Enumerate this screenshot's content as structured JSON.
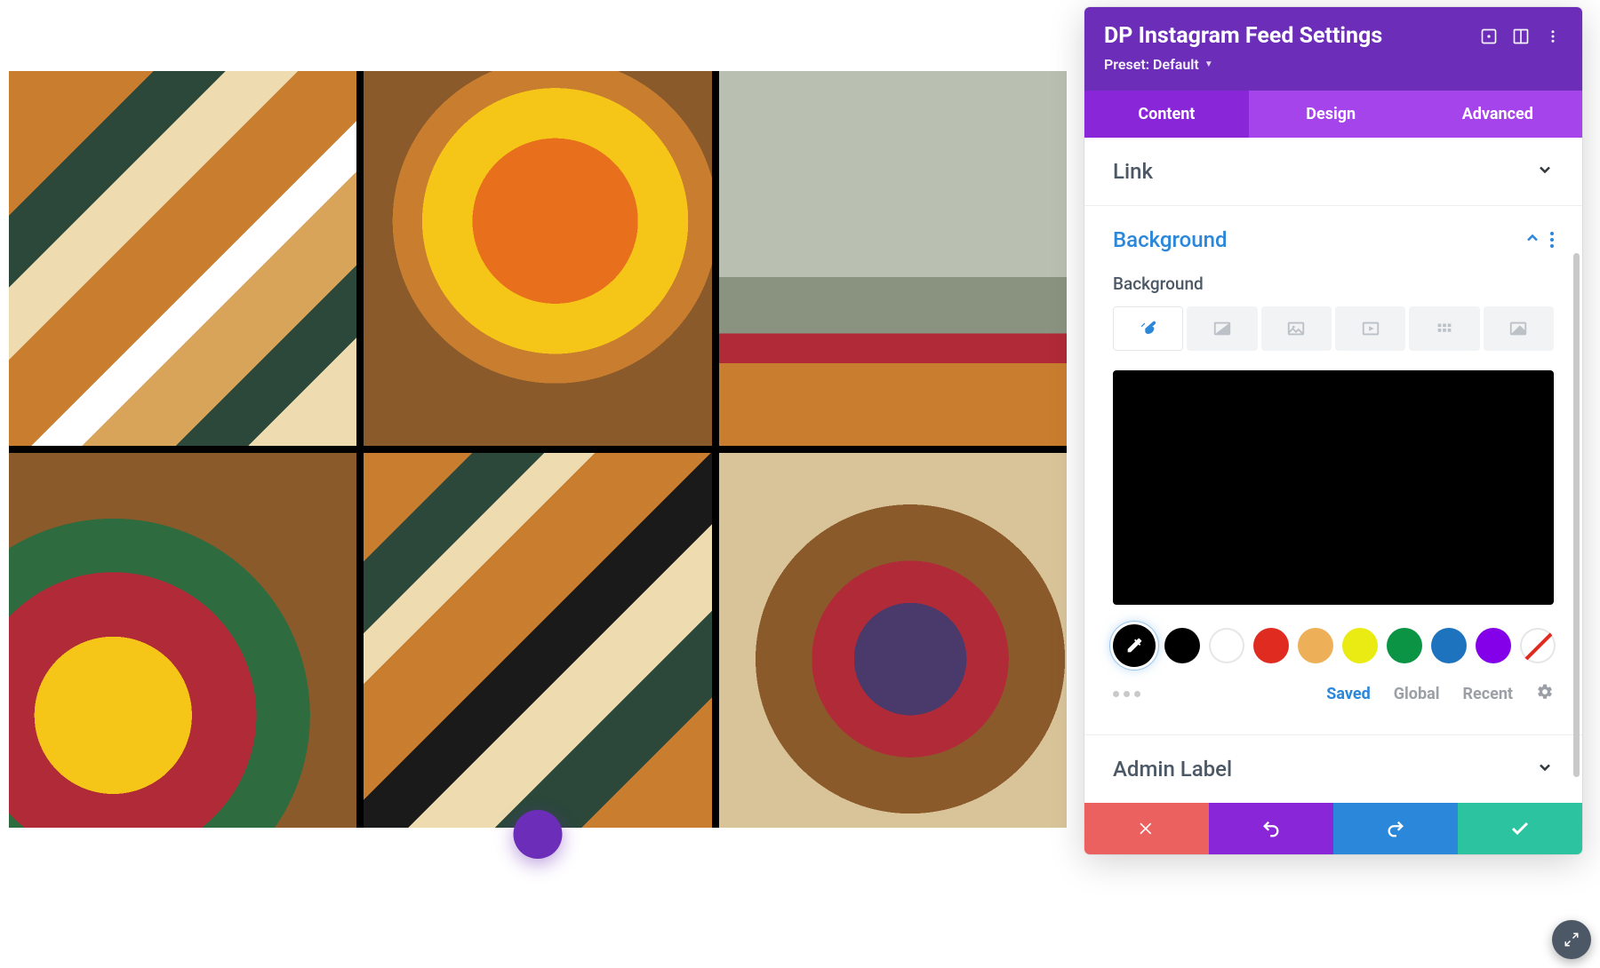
{
  "panel": {
    "title": "DP Instagram Feed Settings",
    "preset_label": "Preset: Default",
    "tabs": [
      "Content",
      "Design",
      "Advanced"
    ],
    "active_tab": 0
  },
  "sections": {
    "link": {
      "title": "Link"
    },
    "background": {
      "title": "Background",
      "field_label": "Background",
      "preview_color": "#000000",
      "type_tabs": [
        "color",
        "gradient",
        "image",
        "video",
        "pattern",
        "mask"
      ],
      "active_type": 0
    },
    "admin_label": {
      "title": "Admin Label"
    }
  },
  "palette": {
    "swatches": [
      "#000000",
      "#ffffff",
      "#e02b20",
      "#edb059",
      "#ebeb14",
      "#0b9444",
      "#1e73be",
      "#8300e9",
      "none"
    ],
    "sub_links": [
      "Saved",
      "Global",
      "Recent"
    ],
    "active_sub": 0
  },
  "footer": {
    "cancel": "cancel",
    "undo": "undo",
    "redo": "redo",
    "save": "save"
  }
}
